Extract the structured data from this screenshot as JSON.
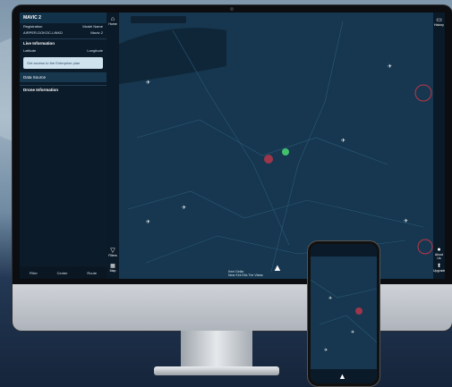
{
  "panel": {
    "aircraft": "MAVIC 2",
    "reg_label": "Registration",
    "reg_value": "AIRPER-DOKOC-LINKD",
    "model_label": "Model Name",
    "model_value": "Mavic 2",
    "live_info": "Live Information",
    "latitude": "Latitude",
    "longitude": "Longitude",
    "promo": "Get access to the Enterprise plan",
    "data_source": "Data Source",
    "drone_info": "Drone Information",
    "bottom": [
      "Filter",
      "Center",
      "Route"
    ]
  },
  "rail": {
    "home": "Home",
    "filters": "Filters",
    "map": "Map"
  },
  "rrail": {
    "history": "History",
    "about": "About Us",
    "upgrade": "Upgrade"
  },
  "map_footer": {
    "line1": "Kent Gellar",
    "line2": "Near Kirk Ella The Vistas"
  },
  "colors": {
    "map": "#16374f",
    "panel": "#0c1b2a",
    "accent": "#cfe3ee",
    "zone": "#c0364a"
  }
}
